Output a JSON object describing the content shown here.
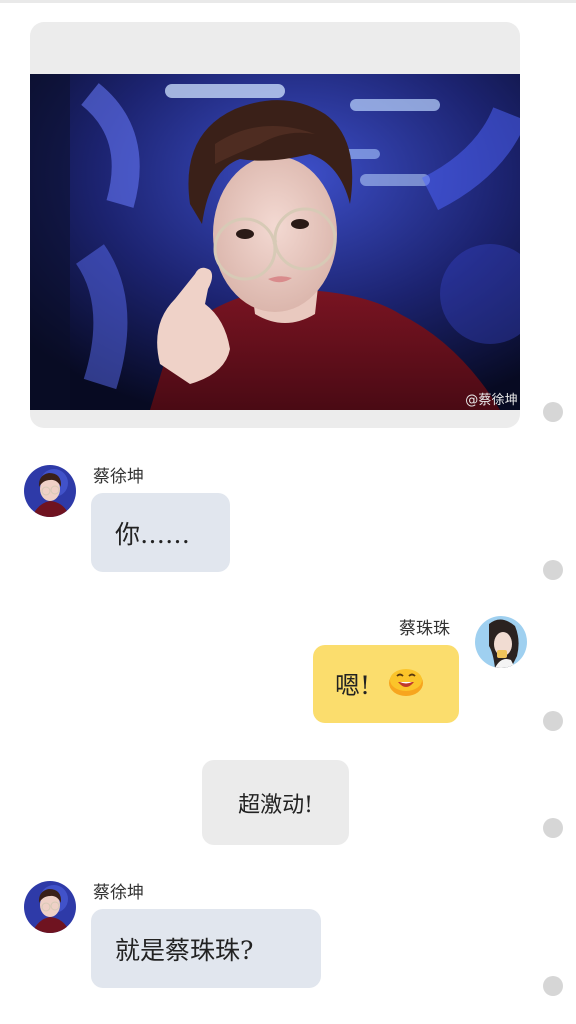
{
  "image_post": {
    "watermark": "@蔡徐坤"
  },
  "messages": [
    {
      "sender": "蔡徐坤",
      "text": "你……",
      "side": "left",
      "avatar_icon": "avatar-kun-icon"
    },
    {
      "sender": "蔡珠珠",
      "text": "嗯!",
      "emoji": "grinning-face-icon",
      "side": "right",
      "avatar_icon": "avatar-zhuzhu-icon"
    },
    {
      "text": "超激动!",
      "side": "center"
    },
    {
      "sender": "蔡徐坤",
      "text": "就是蔡珠珠?",
      "side": "left",
      "avatar_icon": "avatar-kun-icon"
    }
  ],
  "colors": {
    "left_bubble": "#e1e6ee",
    "right_bubble": "#fbdd6d",
    "center_bubble": "#ebebeb",
    "select_dot": "#d6d6d6",
    "card_bg": "#ececec"
  }
}
